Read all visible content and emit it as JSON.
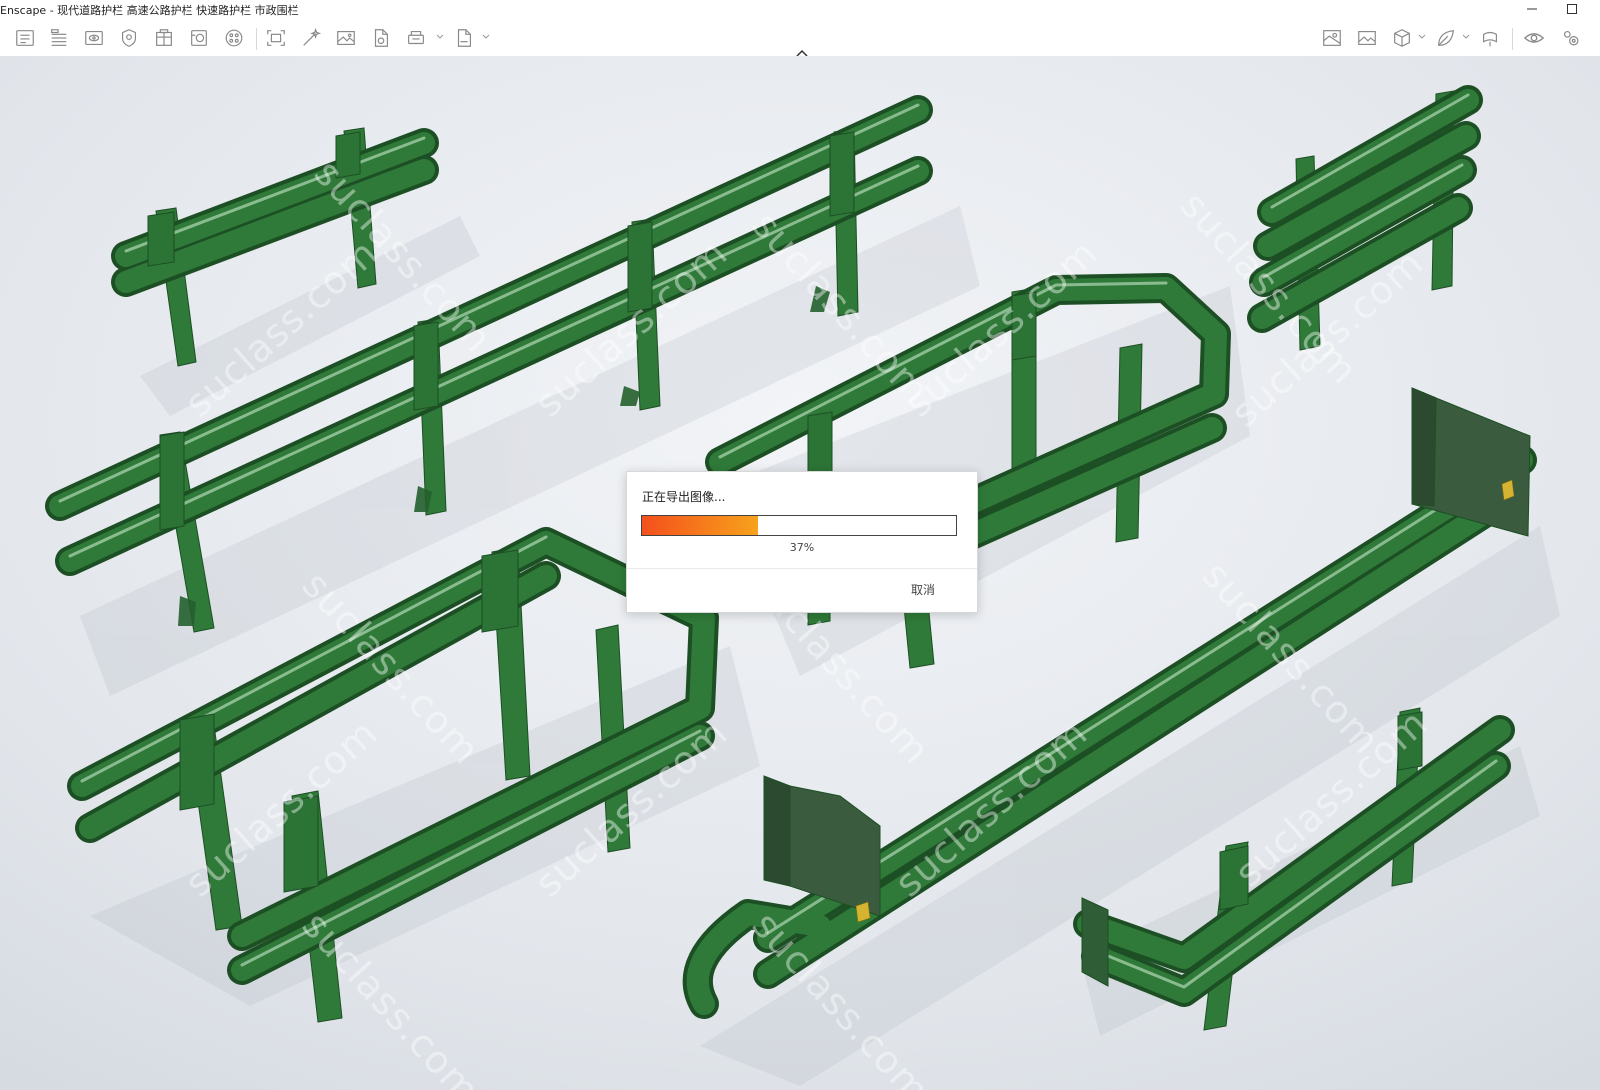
{
  "window": {
    "title": "Enscape - 现代道路护栏 高速公路护栏 快速路护栏 市政围栏",
    "minimize_icon": "minimize-icon",
    "maximize_icon": "maximize-icon"
  },
  "toolbar": {
    "left_icons": [
      "asset-library-icon",
      "bim-icon",
      "view-management-icon",
      "site-context-icon",
      "building-icon",
      "material-icon",
      "color-palette-icon",
      "screenshot-icon",
      "batch-render-icon",
      "render-image-icon",
      "export-file-icon",
      "export-package-icon",
      "export-exe-icon"
    ],
    "right_icons": [
      "views-icon",
      "gallery-icon",
      "cube-icon",
      "leaf-icon",
      "panorama-icon",
      "eye-icon",
      "settings-icon"
    ],
    "collapse_icon": "chevron-up-icon"
  },
  "viewport": {
    "watermark_text": "suclass.com"
  },
  "dialog": {
    "message": "正在导出图像...",
    "progress_percent": 37,
    "progress_label": "37%",
    "cancel_label": "取消",
    "colors": {
      "fill_start": "#f4501c",
      "fill_end": "#f7a21c"
    }
  },
  "colors": {
    "guardrail_green": "#2f7a39",
    "background": "#e6e9ee"
  }
}
